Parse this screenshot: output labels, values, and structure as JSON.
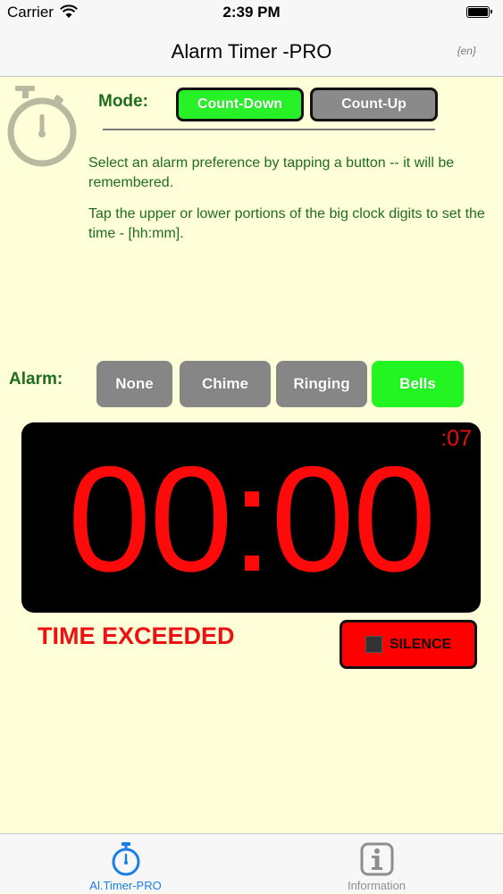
{
  "status_bar": {
    "carrier": "Carrier",
    "time": "2:39 PM"
  },
  "nav": {
    "title": "Alarm Timer -PRO",
    "lang": "{en}"
  },
  "mode": {
    "label": "Mode:",
    "options": [
      "Count-Down",
      "Count-Up"
    ],
    "selected": "Count-Down"
  },
  "instructions": [
    "Select an alarm preference by tapping a button -- it will be remembered.",
    "Tap the upper or lower portions of the big clock digits to set the time - [hh:mm]."
  ],
  "alarm": {
    "label": "Alarm:",
    "options": [
      "None",
      "Chime",
      "Ringing",
      "Bells"
    ],
    "selected": "Bells"
  },
  "clock": {
    "seconds": ":07",
    "time": "00:00"
  },
  "status_message": "TIME EXCEEDED",
  "silence_label": "SILENCE",
  "tabs": [
    {
      "label": "Al.Timer-PRO",
      "icon": "stopwatch-icon",
      "active": true
    },
    {
      "label": "Information",
      "icon": "info-icon",
      "active": false
    }
  ],
  "colors": {
    "background": "#fefed9",
    "green_text": "#1f6d1f",
    "active_button": "#27f227",
    "inactive_button": "#8a8a8a",
    "clock_digits": "#ff0a0a",
    "tab_active": "#1a7ee6",
    "tab_inactive": "#8e8e8e"
  }
}
